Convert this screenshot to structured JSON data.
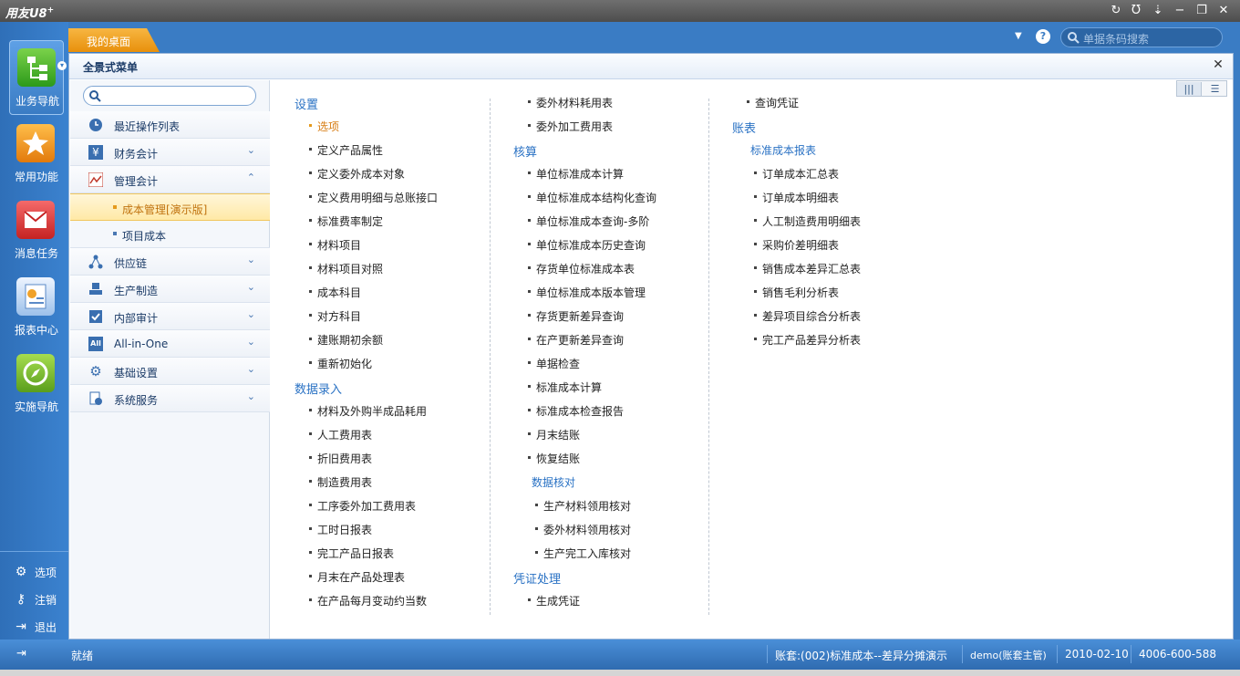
{
  "window": {
    "title": "用友U8",
    "title_sup": "+",
    "controls": [
      "refresh-icon",
      "u-icon",
      "menu-icon",
      "minimize-icon",
      "restore-icon",
      "close-icon"
    ]
  },
  "dock": {
    "items": [
      {
        "label": "业务导航",
        "icon": "business-nav-icon",
        "active": true
      },
      {
        "label": "常用功能",
        "icon": "favorites-icon"
      },
      {
        "label": "消息任务",
        "icon": "message-icon"
      },
      {
        "label": "报表中心",
        "icon": "report-icon"
      },
      {
        "label": "实施导航",
        "icon": "compass-icon"
      }
    ],
    "bottom": [
      {
        "label": "选项",
        "icon": "gear-icon"
      },
      {
        "label": "注销",
        "icon": "key-icon"
      },
      {
        "label": "退出",
        "icon": "exit-icon"
      }
    ]
  },
  "tabs": {
    "desktop": "我的桌面"
  },
  "topsearch": {
    "placeholder": "单据条码搜索"
  },
  "panel": {
    "title": "全景式菜单"
  },
  "nav": {
    "items": [
      {
        "label": "最近操作列表",
        "icon": "clock-icon"
      },
      {
        "label": "财务会计",
        "icon": "yen-icon",
        "chev": "⌄"
      },
      {
        "label": "管理会计",
        "icon": "chart-icon",
        "chev": "⌃"
      },
      {
        "label": "供应链",
        "icon": "network-icon",
        "chev": "⌄"
      },
      {
        "label": "生产制造",
        "icon": "machine-icon",
        "chev": "⌄"
      },
      {
        "label": "内部审计",
        "icon": "check-icon",
        "chev": "⌄"
      },
      {
        "label": "All-in-One",
        "icon": "all-icon",
        "chev": "⌄"
      },
      {
        "label": "基础设置",
        "icon": "settings-icon",
        "chev": "⌄"
      },
      {
        "label": "系统服务",
        "icon": "service-icon",
        "chev": "⌄"
      }
    ],
    "subs": [
      {
        "label": "成本管理[演示版]",
        "selected": true
      },
      {
        "label": "项目成本"
      }
    ]
  },
  "menu": {
    "col1": {
      "sections": [
        {
          "title": "设置",
          "items": [
            "选项",
            "定义产品属性",
            "定义委外成本对象",
            "定义费用明细与总账接口",
            "标准费率制定",
            "材料项目",
            "材料项目对照",
            "成本科目",
            "对方科目",
            "建账期初余额",
            "重新初始化"
          ]
        },
        {
          "title": "数据录入",
          "items": [
            "材料及外购半成品耗用",
            "人工费用表",
            "折旧费用表",
            "制造费用表",
            "工序委外加工费用表",
            "工时日报表",
            "完工产品日报表",
            "月末在产品处理表",
            "在产品每月变动约当数"
          ]
        }
      ]
    },
    "col2": {
      "top_items": [
        "委外材料耗用表",
        "委外加工费用表"
      ],
      "hesuan_title": "核算",
      "hesuan_items": [
        "单位标准成本计算",
        "单位标准成本结构化查询",
        "单位标准成本查询-多阶",
        "单位标准成本历史查询",
        "存货单位标准成本表",
        "单位标准成本版本管理",
        "存货更新差异查询",
        "在产更新差异查询",
        "单据检查",
        "标准成本计算",
        "标准成本检查报告",
        "月末结账",
        "恢复结账"
      ],
      "check_sub": "数据核对",
      "check_items": [
        "生产材料领用核对",
        "委外材料领用核对",
        "生产完工入库核对"
      ],
      "voucher_title": "凭证处理",
      "voucher_items": [
        "生成凭证"
      ]
    },
    "col3": {
      "top_items": [
        "查询凭证"
      ],
      "report_title": "账表",
      "report_sub": "标准成本报表",
      "report_items": [
        "订单成本汇总表",
        "订单成本明细表",
        "人工制造费用明细表",
        "采购价差明细表",
        "销售成本差异汇总表",
        "销售毛利分析表",
        "差异项目综合分析表",
        "完工产品差异分析表"
      ]
    }
  },
  "status": {
    "ready": "就绪",
    "account": "账套:(002)标准成本--差异分摊演示",
    "user": "demo(账套主管)",
    "date": "2010-02-10",
    "phone": "4006-600-588"
  }
}
